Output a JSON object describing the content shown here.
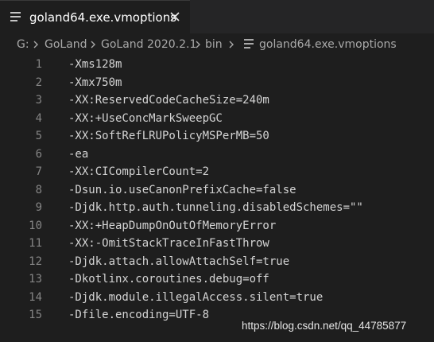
{
  "tab": {
    "title": "goland64.exe.vmoptions",
    "file_icon": "file-lines-icon",
    "close_icon": "close-icon"
  },
  "breadcrumb": {
    "items": [
      "G:",
      "GoLand",
      "GoLand 2020.2.1",
      "bin",
      "goland64.exe.vmoptions"
    ],
    "separator_icon": "chevron-right-icon"
  },
  "editor": {
    "lines": [
      {
        "number": "1",
        "text": "-Xms128m"
      },
      {
        "number": "2",
        "text": "-Xmx750m"
      },
      {
        "number": "3",
        "text": "-XX:ReservedCodeCacheSize=240m"
      },
      {
        "number": "4",
        "text": "-XX:+UseConcMarkSweepGC"
      },
      {
        "number": "5",
        "text": "-XX:SoftRefLRUPolicyMSPerMB=50"
      },
      {
        "number": "6",
        "text": "-ea"
      },
      {
        "number": "7",
        "text": "-XX:CICompilerCount=2"
      },
      {
        "number": "8",
        "text": "-Dsun.io.useCanonPrefixCache=false"
      },
      {
        "number": "9",
        "text": "-Djdk.http.auth.tunneling.disabledSchemes=\"\""
      },
      {
        "number": "10",
        "text": "-XX:+HeapDumpOnOutOfMemoryError"
      },
      {
        "number": "11",
        "text": "-XX:-OmitStackTraceInFastThrow"
      },
      {
        "number": "12",
        "text": "-Djdk.attach.allowAttachSelf=true"
      },
      {
        "number": "13",
        "text": "-Dkotlinx.coroutines.debug=off"
      },
      {
        "number": "14",
        "text": "-Djdk.module.illegalAccess.silent=true"
      },
      {
        "number": "15",
        "text": "-Dfile.encoding=UTF-8"
      }
    ]
  },
  "watermark": "https://blog.csdn.net/qq_44785877",
  "colors": {
    "editor_bg": "#1e1e1e",
    "tabbar_bg": "#252526",
    "line_number": "#858585",
    "code_text": "#d4d4d4"
  }
}
